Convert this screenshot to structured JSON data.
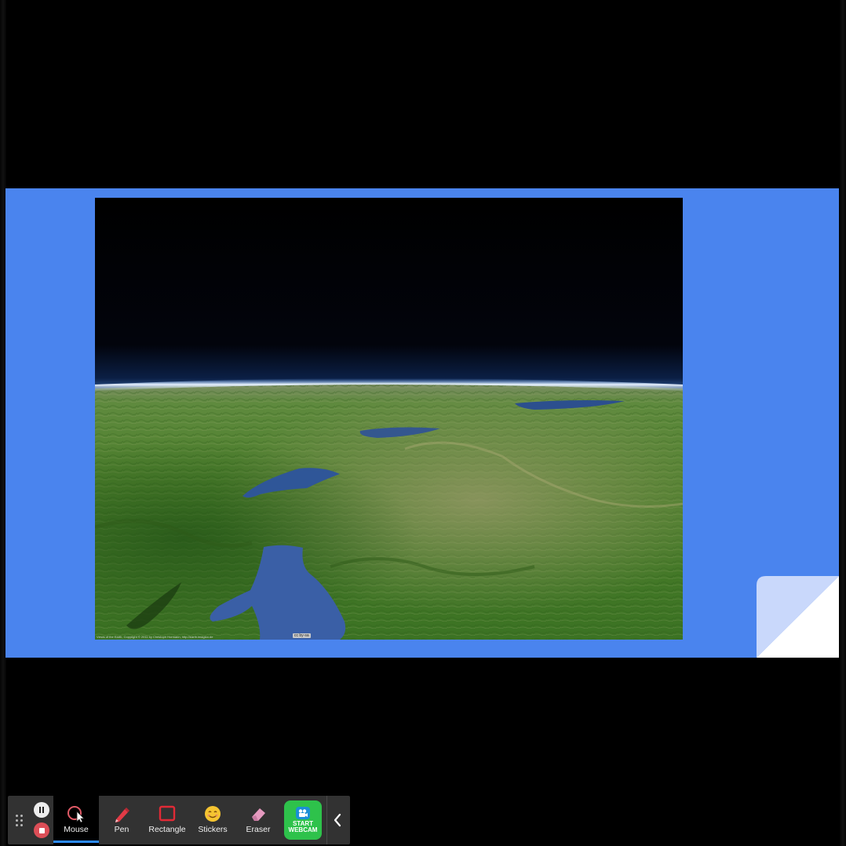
{
  "photo": {
    "credit": "Views of the Earth, Copyright © 2011 by Christoph Hormann, http://earth.imagico.de",
    "license_badge": "cc by-sa"
  },
  "toolbar": {
    "tools": [
      {
        "label": "Mouse",
        "icon": "mouse-cursor-icon",
        "active": true
      },
      {
        "label": "Pen",
        "icon": "pen-icon",
        "active": false
      },
      {
        "label": "Rectangle",
        "icon": "rectangle-icon",
        "active": false
      },
      {
        "label": "Stickers",
        "icon": "smiley-sticker-icon",
        "active": false
      },
      {
        "label": "Eraser",
        "icon": "eraser-icon",
        "active": false
      }
    ],
    "webcam": {
      "line1": "START",
      "line2": "WEBCAM",
      "icon": "webcam-icon"
    },
    "collapse_icon": "chevron-left-icon",
    "pause_icon": "pause-icon",
    "stop_icon": "stop-icon",
    "grip_icon": "drag-handle-icon"
  },
  "colors": {
    "slide_background": "#4a84ee",
    "toolbar_background": "#323232",
    "active_tool_background": "#000000",
    "active_indicator": "#2d8cff",
    "webcam_button": "#2ec24b",
    "stop_button": "#dc4e57"
  }
}
